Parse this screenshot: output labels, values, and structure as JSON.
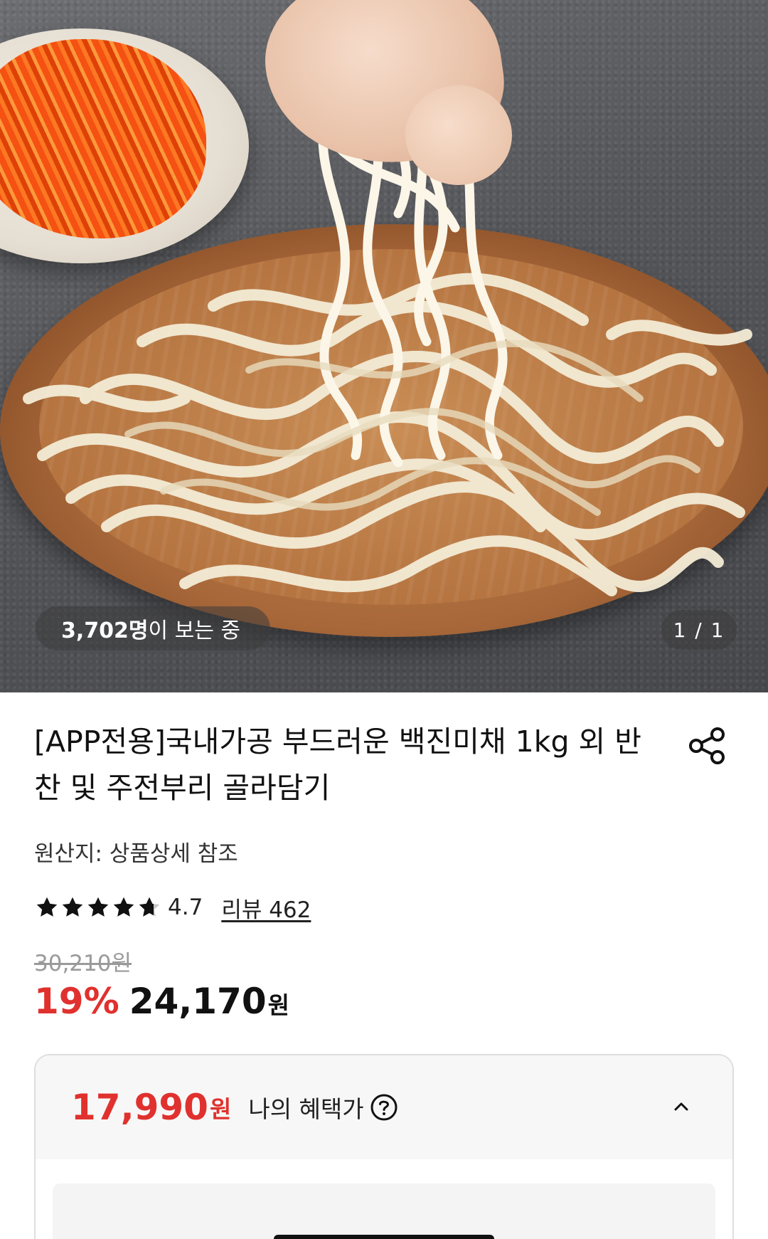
{
  "gallery": {
    "viewer_count": "3,702명",
    "viewer_suffix": "이 보는 중",
    "page_indicator": "1 / 1"
  },
  "product": {
    "title": "[APP전용]국내가공 부드러운 백진미채 1kg 외 반찬 및 주전부리 골라담기",
    "origin": "원산지: 상품상세 참조",
    "rating": "4.7",
    "review_link": "리뷰 462",
    "original_price": "30,210원",
    "discount": "19%",
    "sale_price": "24,170",
    "currency": "원",
    "star_rating_value": 4.7
  },
  "benefit": {
    "price": "17,990",
    "currency": "원",
    "label": "나의 혜택가"
  },
  "icons": {
    "share": "share-icon",
    "help": "question-circle-icon",
    "collapse": "chevron-up-icon",
    "star": "star-icon"
  },
  "colors": {
    "accent_red": "#e0312e",
    "text": "#111111",
    "muted": "#9a9a9a"
  }
}
